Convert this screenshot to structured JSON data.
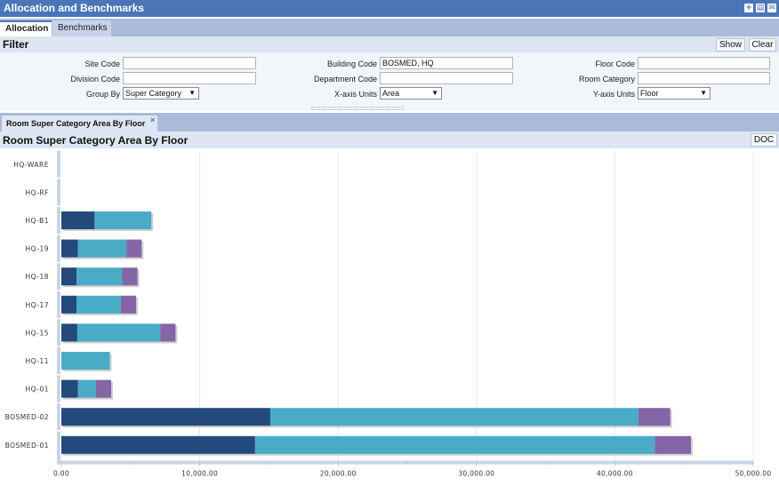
{
  "window": {
    "title": "Allocation and Benchmarks",
    "icons": [
      "add-icon",
      "print-icon",
      "email-icon"
    ]
  },
  "tabs": [
    {
      "label": "Allocation",
      "active": true
    },
    {
      "label": "Benchmarks",
      "active": false
    }
  ],
  "filter": {
    "title": "Filter",
    "show_label": "Show",
    "clear_label": "Clear",
    "fields": {
      "site_code": {
        "label": "Site Code",
        "value": ""
      },
      "building_code": {
        "label": "Building Code",
        "value": "BOSMED, HQ"
      },
      "floor_code": {
        "label": "Floor Code",
        "value": ""
      },
      "division_code": {
        "label": "Division Code",
        "value": ""
      },
      "department_code": {
        "label": "Department Code",
        "value": ""
      },
      "room_category": {
        "label": "Room Category",
        "value": ""
      },
      "group_by": {
        "label": "Group By",
        "value": "Super Category"
      },
      "x_axis_units": {
        "label": "X-axis Units",
        "value": "Area"
      },
      "y_axis_units": {
        "label": "Y-axis Units",
        "value": "Floor"
      }
    }
  },
  "view_tab": {
    "label": "Room Super Category Area By Floor",
    "close": "×"
  },
  "panel": {
    "title": "Room Super Category Area By Floor",
    "doc_label": "DOC"
  },
  "colors": {
    "dark_blue": "#234a7a",
    "light_blue": "#4aabc6",
    "purple": "#8465a6",
    "title_bar": "#4a76b8"
  },
  "chart_data": {
    "type": "bar",
    "orientation": "horizontal",
    "stacked": true,
    "categories": [
      "HQ-WARE",
      "HQ-RF",
      "HQ-B1",
      "HQ-19",
      "HQ-18",
      "HQ-17",
      "HQ-15",
      "HQ-11",
      "HQ-01",
      "BOSMED-02",
      "BOSMED-01"
    ],
    "series": [
      {
        "color": "#234a7a",
        "values": [
          0,
          0,
          2400,
          1200,
          1100,
          1100,
          1150,
          0,
          1200,
          15100,
          14000
        ]
      },
      {
        "color": "#4aabc6",
        "values": [
          0,
          0,
          4100,
          3500,
          3300,
          3200,
          6000,
          3500,
          1300,
          26600,
          28900
        ]
      },
      {
        "color": "#8465a6",
        "values": [
          0,
          0,
          0,
          1100,
          1100,
          1100,
          1100,
          0,
          1100,
          2300,
          2600
        ]
      }
    ],
    "xlim": [
      0,
      50000
    ],
    "xticks": [
      "0.00",
      "10,000.00",
      "20,000.00",
      "30,000.00",
      "40,000.00",
      "50,000.00"
    ],
    "grid": true,
    "legend": "none"
  }
}
